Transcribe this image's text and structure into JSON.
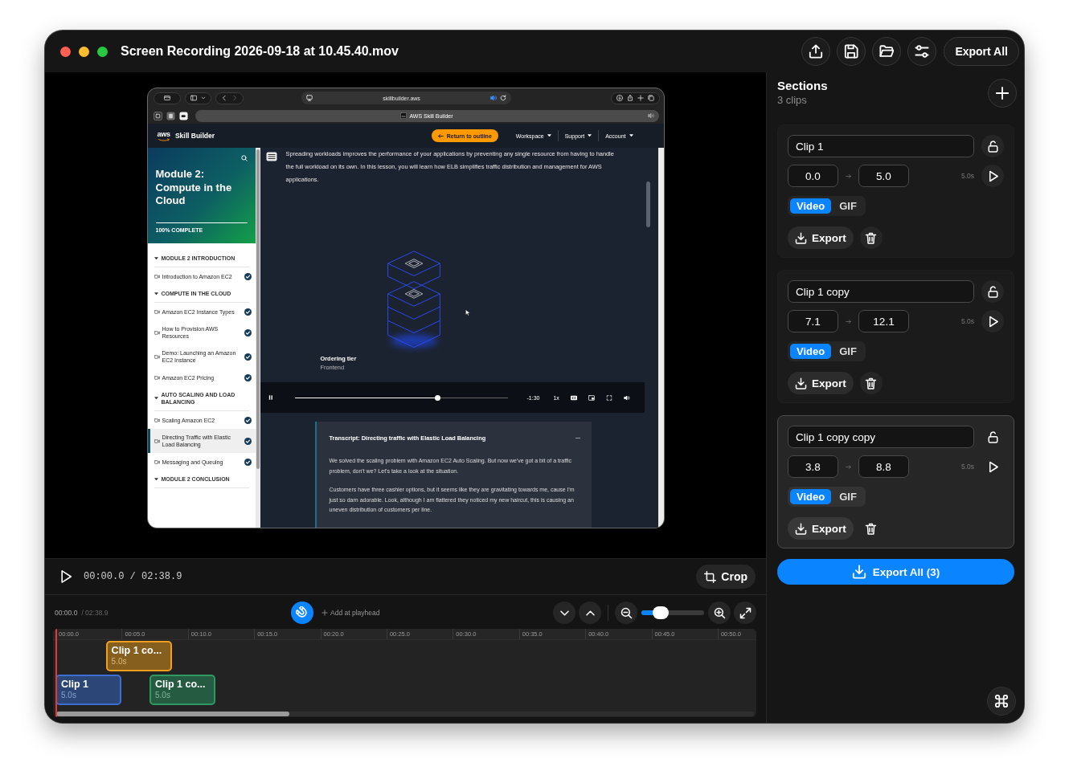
{
  "window": {
    "title": "Screen Recording 2026-09-18 at 10.45.40.mov",
    "export_all": "Export All"
  },
  "preview": {
    "browser": {
      "address": "skillbuilder.aws",
      "tab_title": "AWS Skill Builder"
    },
    "site_header": {
      "logo": "aws",
      "brand": "Skill Builder",
      "return_button": "Return to outline",
      "menus": [
        "Workspace",
        "Support",
        "Account"
      ]
    },
    "course_sidebar": {
      "title": "Module 2: Compute in the Cloud",
      "progress": "100% COMPLETE",
      "level": 1,
      "sections": [
        {
          "title": "MODULE 2 INTRODUCTION",
          "expanded": true,
          "lessons": [
            {
              "title": "Introduction to Amazon EC2",
              "completed": true,
              "selected": false
            }
          ]
        },
        {
          "title": "COMPUTE IN THE CLOUD",
          "expanded": true,
          "lessons": [
            {
              "title": "Amazon EC2 Instance Types",
              "completed": true,
              "selected": false
            },
            {
              "title": "How to Provision AWS Resources",
              "completed": true,
              "selected": false
            },
            {
              "title": "Demo: Launching an Amazon EC2 Instance",
              "completed": true,
              "selected": false
            },
            {
              "title": "Amazon EC2 Pricing",
              "completed": true,
              "selected": false
            }
          ]
        },
        {
          "title": "AUTO SCALING AND LOAD BALANCING",
          "expanded": true,
          "lessons": [
            {
              "title": "Scaling Amazon EC2",
              "completed": true,
              "selected": false
            },
            {
              "title": "Directing Traffic with Elastic Load Balancing",
              "completed": true,
              "selected": true
            },
            {
              "title": "Messaging and Queuing",
              "completed": true,
              "selected": false
            }
          ]
        },
        {
          "title": "MODULE 2 CONCLUSION",
          "expanded": true
        }
      ]
    },
    "lesson": {
      "intro": "Spreading workloads improves the performance of your applications by preventing any single resource from having to handle the full workload on its own. In this lesson, you will learn how ELB simplifies traffic distribution and management for AWS applications.",
      "video": {
        "caption_title": "Ordering tier",
        "caption_subtitle": "Frontend",
        "playing": true,
        "level": 0.67,
        "time": "-1:30",
        "speed": "1x"
      },
      "transcript": {
        "title": "Transcript: Directing traffic with Elastic Load Balancing",
        "expanded": true,
        "paragraphs": [
          "We solved the scaling problem with Amazon EC2 Auto Scaling. But now we've got a bit of a traffic problem, don't we? Let's take a look at the situation.",
          "Customers have three cashier options, but it seems like they are gravitating towards me, cause I'm just so darn adorable. Look, although I am flattered they noticed my new haircut, this is causing an uneven distribution of customers per line."
        ]
      }
    }
  },
  "playback": {
    "playing": false,
    "time": "00:00.0 / 02:38.9",
    "crop_button": "Crop"
  },
  "timeline": {
    "time": "00:00.0",
    "duration": "/ 02:38.9",
    "snap": true,
    "add_button": "Add at playhead",
    "zoom": {
      "level": 0.24
    },
    "ruler": [
      "00:00.0",
      "00:05.0",
      "00:10.0",
      "00:15.0",
      "00:20.0",
      "00:25.0",
      "00:30.0",
      "00:35.0",
      "00:40.0",
      "00:45.0",
      "00:50.0"
    ],
    "clips": [
      {
        "label": "Clip 1",
        "duration": "5.0s",
        "color": "#3b6fd4"
      },
      {
        "label": "Clip 1 co...",
        "duration": "5.0s",
        "color": "#2e9a63"
      },
      {
        "label": "Clip 1 co...",
        "duration": "5.0s",
        "color": "#f0a020"
      }
    ]
  },
  "sections": {
    "title": "Sections",
    "count": "3 clips",
    "items": [
      {
        "name": "Clip 1",
        "start": "0.0",
        "end": "5.0",
        "duration": "5.0s",
        "locked": false,
        "formats": [
          {
            "label": "Video",
            "selected": true
          },
          {
            "label": "GIF",
            "selected": false
          }
        ],
        "export_button": "Export",
        "selected": false
      },
      {
        "name": "Clip 1 copy",
        "start": "7.1",
        "end": "12.1",
        "duration": "5.0s",
        "locked": false,
        "formats": [
          {
            "label": "Video",
            "selected": true
          },
          {
            "label": "GIF",
            "selected": false
          }
        ],
        "export_button": "Export",
        "selected": false
      },
      {
        "name": "Clip 1 copy copy",
        "start": "3.8",
        "end": "8.8",
        "duration": "5.0s",
        "locked": false,
        "formats": [
          {
            "label": "Video",
            "selected": true
          },
          {
            "label": "GIF",
            "selected": false
          }
        ],
        "export_button": "Export",
        "selected": true
      }
    ],
    "export_all": "Export All (3)"
  }
}
